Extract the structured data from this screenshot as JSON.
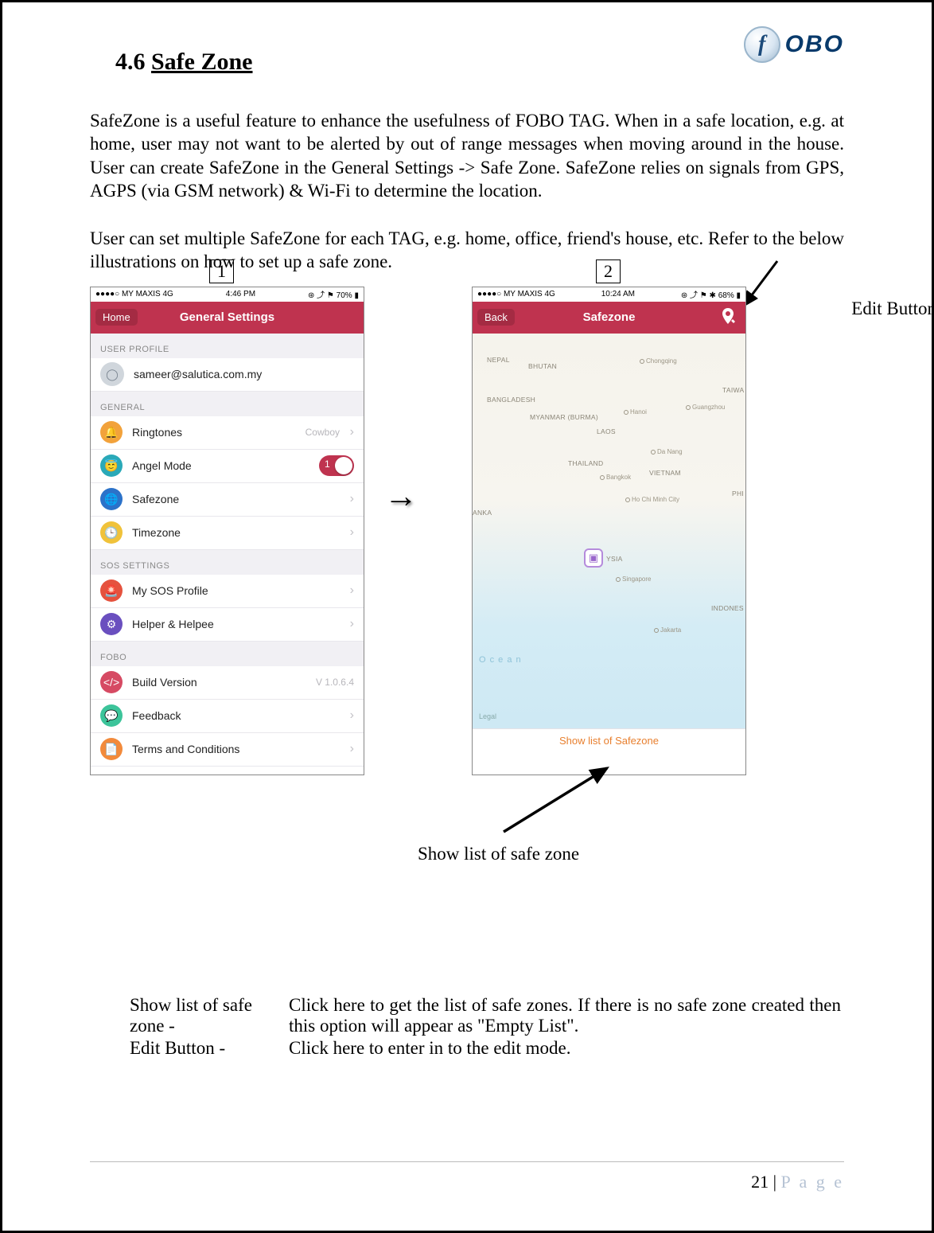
{
  "logo": {
    "glyph": "f",
    "text": "OBO"
  },
  "heading": {
    "num": "4.6",
    "title": "Safe Zone"
  },
  "para1": "SafeZone is a useful feature to enhance the usefulness of FOBO TAG. When in a safe location, e.g. at home, user may not want to be alerted by out of range messages when moving around in the house. User can create SafeZone in the General Settings -> Safe Zone. SafeZone relies on signals from GPS, AGPS (via GSM network) & Wi-Fi to determine the location.",
  "para2": "User can set multiple SafeZone for each TAG, e.g. home, office, friend's house, etc. Refer to the below illustrations on how to set up a safe zone.",
  "annotations": {
    "edit_button": "Edit Button",
    "num1": "1",
    "num2": "2",
    "show_list_caption": "Show list of safe zone"
  },
  "phone1": {
    "status": {
      "left": "●●●●○ MY MAXIS  4G",
      "center": "4:46 PM",
      "right": "⊛ ⤴ ⚑ 70% ▮"
    },
    "nav": {
      "back": "Home",
      "title": "General Settings"
    },
    "sections": {
      "user_profile": {
        "label": "USER PROFILE",
        "email": "sameer@salutica.com.my"
      },
      "general": {
        "label": "GENERAL",
        "ringtones": {
          "label": "Ringtones",
          "value": "Cowboy"
        },
        "angel_mode": {
          "label": "Angel Mode",
          "toggle": "1"
        },
        "safezone": "Safezone",
        "timezone": "Timezone"
      },
      "sos": {
        "label": "SOS SETTINGS",
        "profile": "My SOS Profile",
        "helper": "Helper & Helpee"
      },
      "fobo": {
        "label": "FOBO",
        "build": {
          "label": "Build Version",
          "value": "V 1.0.6.4"
        },
        "feedback": "Feedback",
        "terms": "Terms and Conditions"
      }
    }
  },
  "phone2": {
    "status": {
      "left": "●●●●○ MY MAXIS  4G",
      "center": "10:24 AM",
      "right": "⊛ ⤴ ⚑ ✱ 68% ▮"
    },
    "nav": {
      "back": "Back",
      "title": "Safezone"
    },
    "map": {
      "countries": [
        "NEPAL",
        "BHUTAN",
        "BANGLADESH",
        "MYANMAR (BURMA)",
        "LAOS",
        "THAILAND",
        "VIETNAM",
        "TAIWA",
        "PHI",
        "INDONES",
        "ANKA",
        "YSIA"
      ],
      "cities": [
        "Chongqing",
        "Hanoi",
        "Guangzhou",
        "Da Nang",
        "Bangkok",
        "Ho Chi Minh City",
        "Singapore",
        "Jakarta"
      ],
      "ocean": "O c e a n",
      "legal": "Legal"
    },
    "show_list": "Show list of Safezone"
  },
  "definitions": {
    "row1": {
      "term": "Show list of safe zone -",
      "desc": "Click here to get the list of safe zones. If there is no safe zone created then this option will appear as \"Empty List\"."
    },
    "row2": {
      "term": "Edit Button -",
      "desc": "Click here to enter in to the edit mode."
    }
  },
  "footer": {
    "num": "21",
    "sep": " | ",
    "word": "P a g e"
  }
}
